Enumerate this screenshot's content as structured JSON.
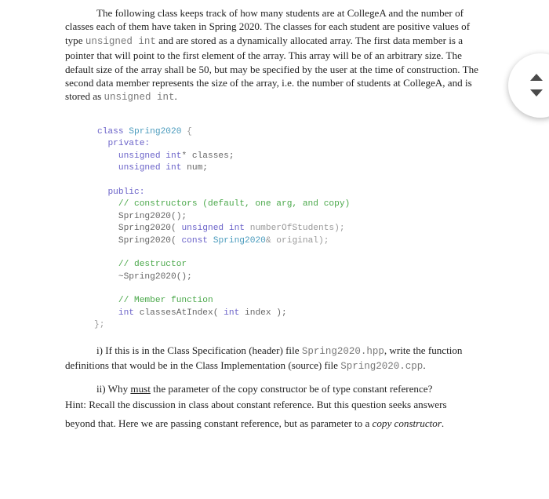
{
  "intro": {
    "s1": "The following class keeps track of how many students are at CollegeA and the number of classes each of them have taken in Spring 2020. The classes for each student are positive values of type ",
    "type1": "unsigned int",
    "s2": " and are stored as a dynamically allocated array. The first data member is a pointer that will point to the first element of the array. This array will be of an arbitrary size. The default size of the array shall be 50, but may be specified  by the user at the time of construction. The second data member represents the size of the array, i.e. the number of students at CollegeA, and is stored as ",
    "type2": "unsigned int",
    "s3": "."
  },
  "code": {
    "class_kw": "class",
    "class_name": "Spring2020",
    "open_brace": " {",
    "private_label": "private:",
    "m1_type": "unsigned int",
    "m1_rest": "* classes;",
    "m2_type": "unsigned int",
    "m2_rest": " num;",
    "public_label": "public:",
    "ctor_comment": "// constructors (default, one arg, and copy)",
    "ctor1": "Spring2020();",
    "ctor2_a": "Spring2020( ",
    "ctor2_type": "unsigned int",
    "ctor2_b": " numberOfStudents);",
    "ctor3_a": "Spring2020( ",
    "ctor3_kw": "const",
    "ctor3_type": " Spring2020",
    "ctor3_b": "& original);",
    "dtor_comment": "// destructor",
    "dtor": "~Spring2020();",
    "member_comment": "// Member function",
    "mf_type": "int",
    "mf_a": " classesAtIndex( ",
    "mf_ptype": "int",
    "mf_b": " index );",
    "close": "};"
  },
  "question1": {
    "a": "i) If this is in the Class Specification (header) file ",
    "file1": "Spring2020.hpp",
    "b": ", write the function definitions that would be in the Class Implementation (source) file ",
    "file2": "Spring2020.cpp",
    "c": "."
  },
  "question2": {
    "a": "ii) Why ",
    "must": "must",
    "b": " the parameter of the copy constructor be of type constant reference?",
    "hint": "Hint: Recall the discussion in class about constant reference. But this question seeks answers",
    "c": "beyond that. Here we are passing constant reference, but as parameter to a ",
    "copy_ctor": "copy constructor",
    "d": "."
  },
  "nav": {
    "up_icon": "triangle-up",
    "down_icon": "triangle-down"
  }
}
